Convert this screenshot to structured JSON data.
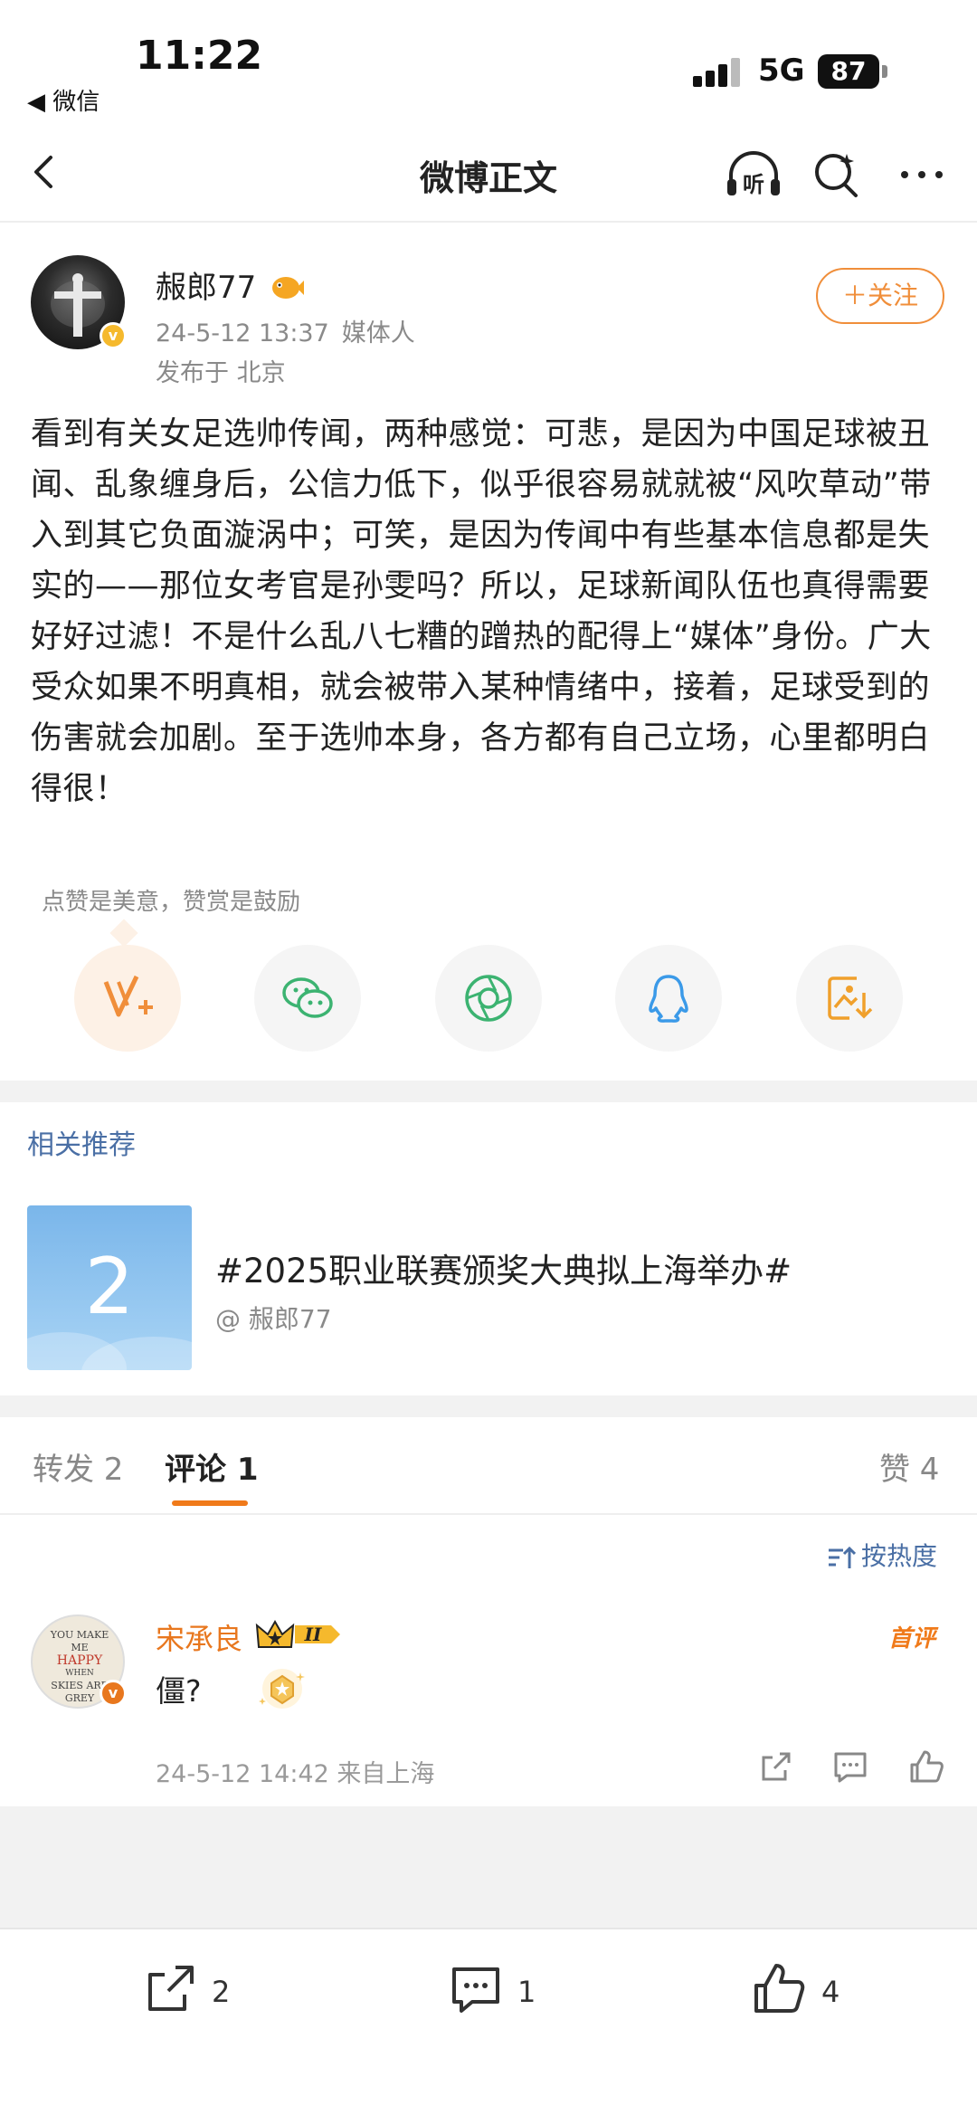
{
  "status_bar": {
    "time": "11:22",
    "back_app": "◀ 微信",
    "network": "5G",
    "battery": "87"
  },
  "nav": {
    "title": "微博正文",
    "back_icon": "chevron-left-icon",
    "listen_icon": "headphone-listen-icon",
    "search_icon": "search-icon",
    "more_icon": "more-dots-icon"
  },
  "author": {
    "name": "赧郎77",
    "date": "24-5-12 13:37",
    "verified_type": "媒体人",
    "location": "发布于 北京",
    "follow_label": "＋关注",
    "verified_color": "#f5b92d"
  },
  "post": {
    "body": "看到有关女足选帅传闻，两种感觉：可悲，是因为中国足球被丑闻、乱象缠身后，公信力低下，似乎很容易就就被“风吹草动”带入到其它负面漩涡中；可笑，是因为传闻中有些基本信息都是失实的——那位女考官是孙雯吗？所以，足球新闻队伍也真得需要好好过滤！不是什么乱八七糟的蹭热的配得上“媒体”身份。广大受众如果不明真相，就会被带入某种情绪中，接着，足球受到的伤害就会加剧。至于选帅本身，各方都有自己立场，心里都明白得很！"
  },
  "reward": {
    "hint": "点赞是美意，赞赏是鼓励"
  },
  "share_buttons": [
    {
      "icon": "reward-v-plus-icon"
    },
    {
      "icon": "wechat-icon"
    },
    {
      "icon": "moments-icon"
    },
    {
      "icon": "qq-icon"
    },
    {
      "icon": "save-image-icon"
    }
  ],
  "recommend": {
    "section_title": "相关推荐",
    "card_number": "2",
    "headline": "#2025职业联赛颁奖大典拟上海举办#",
    "source": "@ 赧郎77"
  },
  "tabs": {
    "repost": "转发 2",
    "comment": "评论 1",
    "like": "赞 4",
    "sort_label": "按热度"
  },
  "comment": {
    "name": "宋承良",
    "rank_label": "II",
    "badge": "首评",
    "text": "僵?",
    "meta": "24-5-12 14:42  来自上海",
    "avatar_lines": [
      "YOU MAKE",
      "ME",
      "HAPPY",
      "WHEN",
      "SKIES ARE",
      "GREY"
    ]
  },
  "bottom_bar": {
    "repost_count": "2",
    "comment_count": "1",
    "like_count": "4"
  },
  "colors": {
    "accent": "#f08e3a",
    "link": "#4a6fa5",
    "tab_underline": "#f07a1a"
  }
}
